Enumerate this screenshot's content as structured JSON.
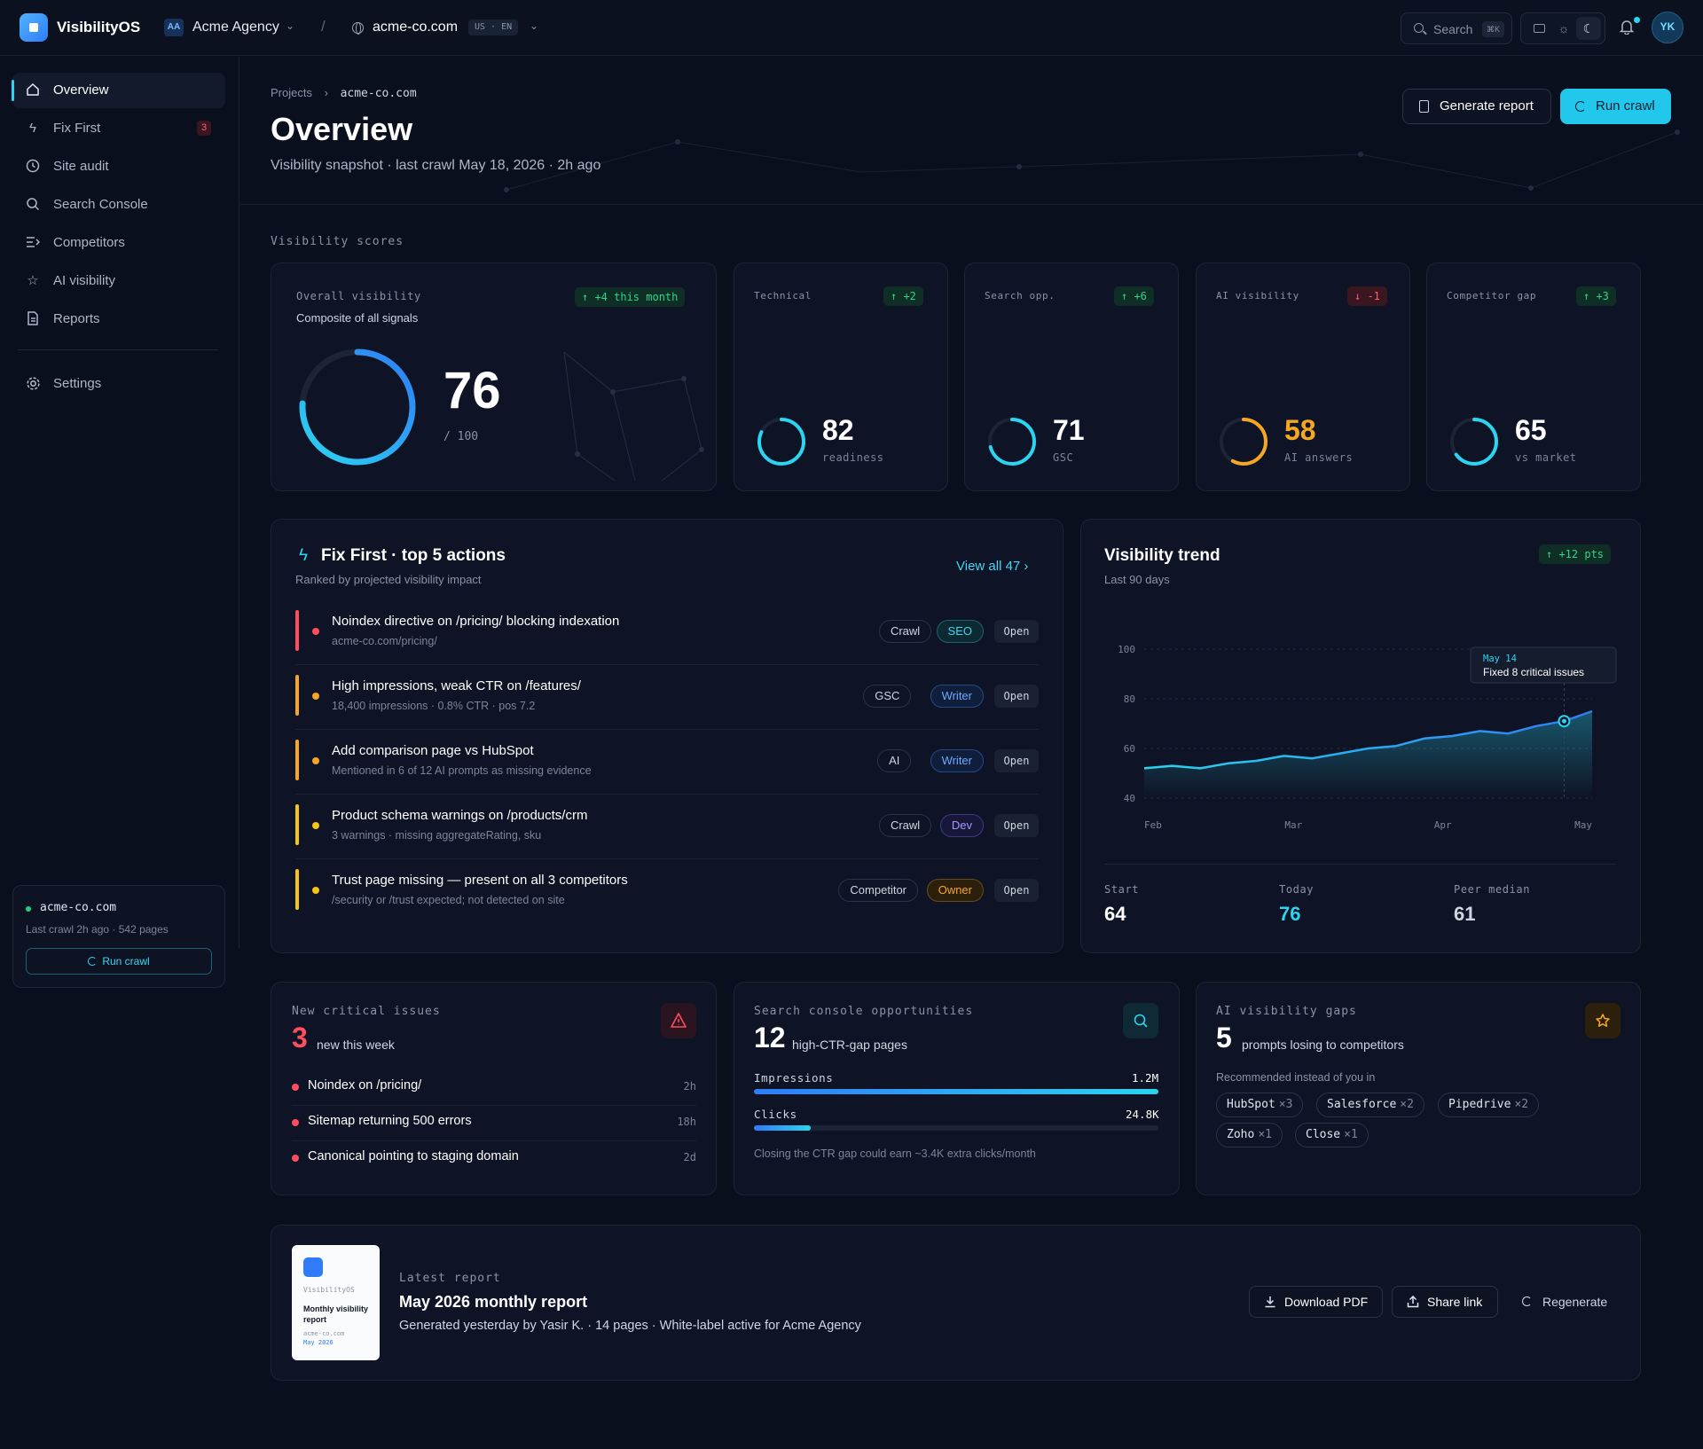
{
  "app": {
    "name": "VisibilityOS"
  },
  "topbar": {
    "agency_badge": "AA",
    "agency": "Acme Agency",
    "separator": "/",
    "site": "acme-co.com",
    "locale": "US · EN",
    "search_label": "Search",
    "search_kbd": "⌘K",
    "avatar": "YK"
  },
  "sidebar": {
    "items": [
      {
        "label": "Overview",
        "icon": "home-icon"
      },
      {
        "label": "Fix First",
        "icon": "bolt-icon",
        "count": "3"
      },
      {
        "label": "Site audit",
        "icon": "clock-icon"
      },
      {
        "label": "Search Console",
        "icon": "search-icon"
      },
      {
        "label": "Competitors",
        "icon": "compare-icon"
      },
      {
        "label": "AI visibility",
        "icon": "star-icon"
      },
      {
        "label": "Reports",
        "icon": "document-icon"
      },
      {
        "label": "Settings",
        "icon": "gear-icon"
      }
    ],
    "site_card": {
      "name": "acme-co.com",
      "meta": "Last crawl 2h ago · 542 pages",
      "button": "Run crawl"
    }
  },
  "header": {
    "breadcrumb_root": "Projects",
    "breadcrumb_sep": "›",
    "breadcrumb_current": "acme-co.com",
    "title": "Overview",
    "subtitle": "Visibility snapshot · last crawl May 18, 2026 · 2h ago",
    "generate_label": "Generate report",
    "run_label": "Run crawl"
  },
  "scores": {
    "section_label": "Visibility scores",
    "overall": {
      "label": "Overall visibility",
      "sub": "Composite of all signals",
      "delta": "↑ +4 this month",
      "value": "76",
      "of": "/ 100",
      "fraction": 0.76
    },
    "cards": [
      {
        "label": "Technical",
        "delta": "↑ +2",
        "value": "82",
        "sub": "readiness",
        "fraction": 0.82,
        "color": "#2bd4f0",
        "dir": "up"
      },
      {
        "label": "Search opp.",
        "delta": "↑ +6",
        "value": "71",
        "sub": "GSC",
        "fraction": 0.71,
        "color": "#2bd4f0",
        "dir": "up"
      },
      {
        "label": "AI visibility",
        "delta": "↓ -1",
        "value": "58",
        "sub": "AI answers",
        "fraction": 0.58,
        "color": "#f5a623",
        "dir": "down"
      },
      {
        "label": "Competitor gap",
        "delta": "↑ +3",
        "value": "65",
        "sub": "vs market",
        "fraction": 0.65,
        "color": "#2bd4f0",
        "dir": "up"
      }
    ]
  },
  "fix_first": {
    "title": "Fix First · top 5 actions",
    "subtitle": "Ranked by projected visibility impact",
    "view_all": "View all 47 ›",
    "open_label": "Open",
    "items": [
      {
        "title": "Noindex directive on /pricing/ blocking indexation",
        "sub": "acme-co.com/pricing/",
        "severity": "#ff4d5e",
        "tags": [
          "Crawl",
          "SEO"
        ]
      },
      {
        "title": "High impressions, weak CTR on /features/",
        "sub": "18,400 impressions · 0.8% CTR · pos 7.2",
        "severity": "#f5a623",
        "tags": [
          "GSC",
          "Writer"
        ]
      },
      {
        "title": "Add comparison page vs HubSpot",
        "sub": "Mentioned in 6 of 12 AI prompts as missing evidence",
        "severity": "#f5a623",
        "tags": [
          "AI",
          "Writer"
        ]
      },
      {
        "title": "Product schema warnings on /products/crm",
        "sub": "3 warnings · missing aggregateRating, sku",
        "severity": "#f5c518",
        "tags": [
          "Crawl",
          "Dev"
        ]
      },
      {
        "title": "Trust page missing — present on all 3 competitors",
        "sub": "/security or /trust expected; not detected on site",
        "severity": "#f5c518",
        "tags": [
          "Competitor",
          "Owner"
        ]
      }
    ]
  },
  "trend": {
    "title": "Visibility trend",
    "subtitle": "Last 90 days",
    "delta": "↑ +12 pts",
    "annotation_date": "May 14",
    "annotation_text": "Fixed 8 critical issues",
    "stats": [
      {
        "label": "Start",
        "value": "64",
        "color": "#ffffff"
      },
      {
        "label": "Today",
        "value": "76",
        "color": "#2bd4f0"
      },
      {
        "label": "Peer median",
        "value": "61",
        "color": "#cfd6e2"
      }
    ]
  },
  "chart_data": {
    "type": "area",
    "title": "Visibility trend",
    "xlabel": "",
    "ylabel": "",
    "x_ticks": [
      "Feb",
      "Mar",
      "Apr",
      "May"
    ],
    "y_ticks": [
      100,
      80,
      60,
      40
    ],
    "ylim": [
      40,
      100
    ],
    "grid": true,
    "x": [
      0,
      1,
      2,
      3,
      4,
      5,
      6,
      7,
      8,
      9,
      10,
      11,
      12,
      13,
      14,
      15
    ],
    "values": [
      52,
      53,
      52,
      54,
      55,
      57,
      56,
      58,
      60,
      61,
      64,
      65,
      67,
      66,
      69,
      71,
      75
    ],
    "annotation_index": 15
  },
  "critical": {
    "label": "New critical issues",
    "count": "3",
    "count_sub": "new this week",
    "items": [
      {
        "text": "Noindex on /pricing/",
        "time": "2h"
      },
      {
        "text": "Sitemap returning 500 errors",
        "time": "18h"
      },
      {
        "text": "Canonical pointing to staging domain",
        "time": "2d"
      }
    ]
  },
  "search_console": {
    "label": "Search console opportunities",
    "count": "12",
    "count_sub": "high-CTR-gap pages",
    "impressions_label": "Impressions",
    "impressions_value": "1.2M",
    "impressions_fraction": 1.0,
    "clicks_label": "Clicks",
    "clicks_value": "24.8K",
    "clicks_fraction": 0.14,
    "note": "Closing the CTR gap could earn ~3.4K extra clicks/month"
  },
  "ai_gaps": {
    "label": "AI visibility gaps",
    "count": "5",
    "count_sub": "prompts losing to competitors",
    "rec_label": "Recommended instead of you in",
    "brands": [
      {
        "name": "HubSpot",
        "count": "×3"
      },
      {
        "name": "Salesforce",
        "count": "×2"
      },
      {
        "name": "Pipedrive",
        "count": "×2"
      },
      {
        "name": "Zoho",
        "count": "×1"
      },
      {
        "name": "Close",
        "count": "×1"
      }
    ]
  },
  "report": {
    "thumb_brand": "VisibilityOS",
    "thumb_title": "Monthly visibility report",
    "thumb_site": "acme-co.com",
    "thumb_date": "May 2026",
    "label": "Latest report",
    "title": "May 2026 monthly report",
    "sub": "Generated yesterday by Yasir K. · 14 pages · White-label active for Acme Agency",
    "download": "Download PDF",
    "share": "Share link",
    "regenerate": "Regenerate"
  }
}
